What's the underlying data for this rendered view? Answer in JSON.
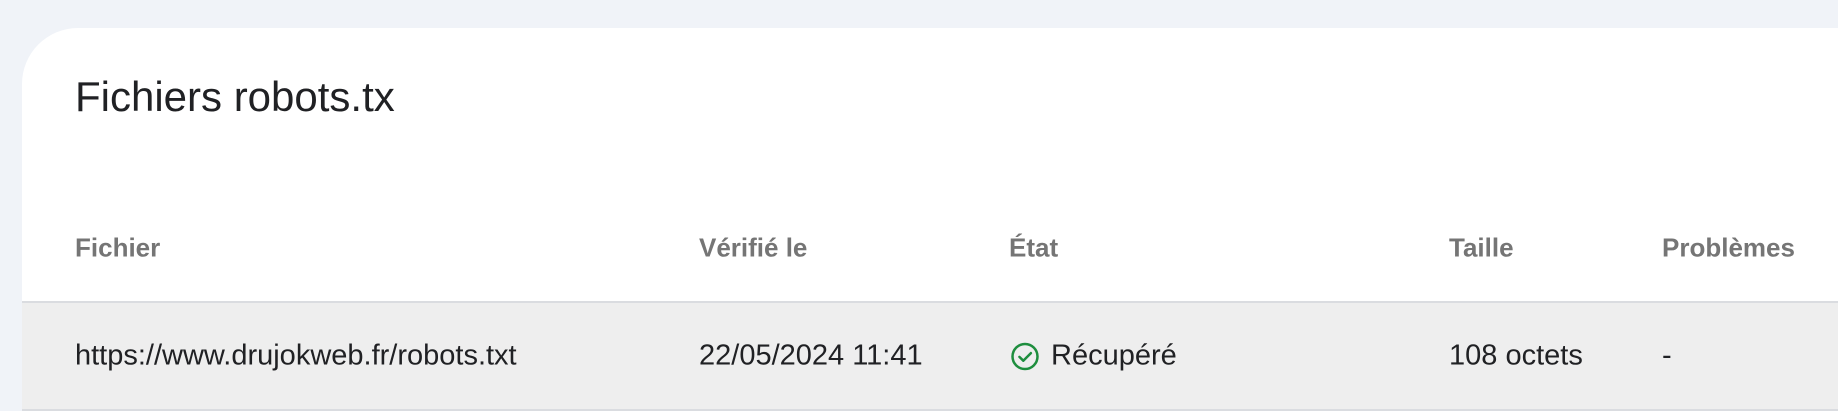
{
  "page": {
    "title": "Fichiers robots.tx"
  },
  "table": {
    "headers": {
      "file": "Fichier",
      "checked": "Vérifié le",
      "state": "État",
      "size": "Taille",
      "issues": "Problèmes"
    },
    "rows": [
      {
        "file": "https://www.drujokweb.fr/robots.txt",
        "checked": "22/05/2024 11:41",
        "state": "Récupéré",
        "state_icon": "check-circle-icon",
        "state_color": "#1e8e3e",
        "size": "108 octets",
        "issues": "-"
      }
    ]
  },
  "colors": {
    "page_background": "#f0f3f8",
    "card_background": "#ffffff",
    "row_background": "#eeeeee",
    "header_text": "#757575",
    "body_text": "#202124"
  }
}
